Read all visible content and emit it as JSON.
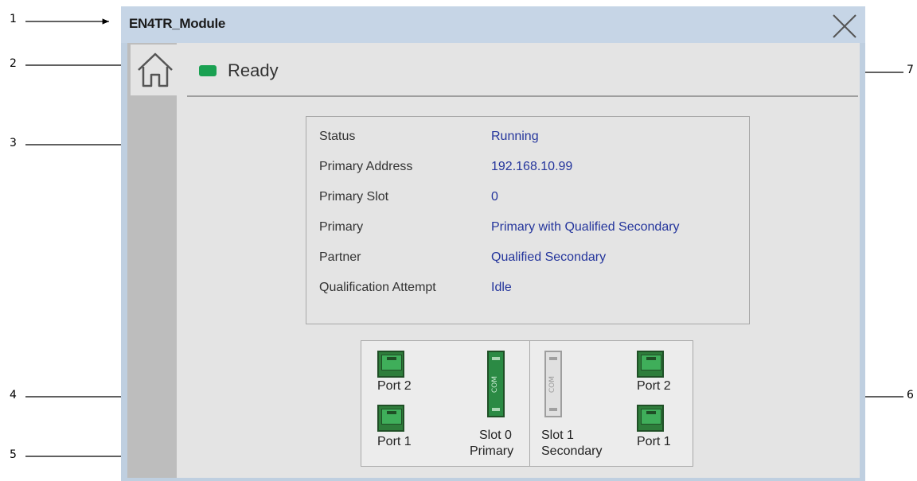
{
  "window": {
    "title": "EN4TR_Module"
  },
  "header": {
    "status_text": "Ready",
    "status_color": "#1aa152"
  },
  "status_panel": {
    "rows": [
      {
        "label": "Status",
        "value": "Running"
      },
      {
        "label": "Primary Address",
        "value": "192.168.10.99"
      },
      {
        "label": "Primary Slot",
        "value": "0"
      },
      {
        "label": "Primary",
        "value": "Primary with Qualified Secondary"
      },
      {
        "label": "Partner",
        "value": "Qualified Secondary"
      },
      {
        "label": "Qualification Attempt",
        "value": "Idle"
      }
    ]
  },
  "module": {
    "primary": {
      "port_top": "Port 2",
      "port_bottom": "Port 1",
      "com_label": "COM",
      "slot": "Slot 0",
      "role": "Primary"
    },
    "secondary": {
      "port_top": "Port 2",
      "port_bottom": "Port 1",
      "com_label": "COM",
      "slot": "Slot 1",
      "role": "Secondary"
    }
  },
  "callouts": [
    "1",
    "2",
    "3",
    "4",
    "5",
    "6",
    "7"
  ],
  "icons": {
    "home": "home-icon",
    "close": "close-icon"
  }
}
